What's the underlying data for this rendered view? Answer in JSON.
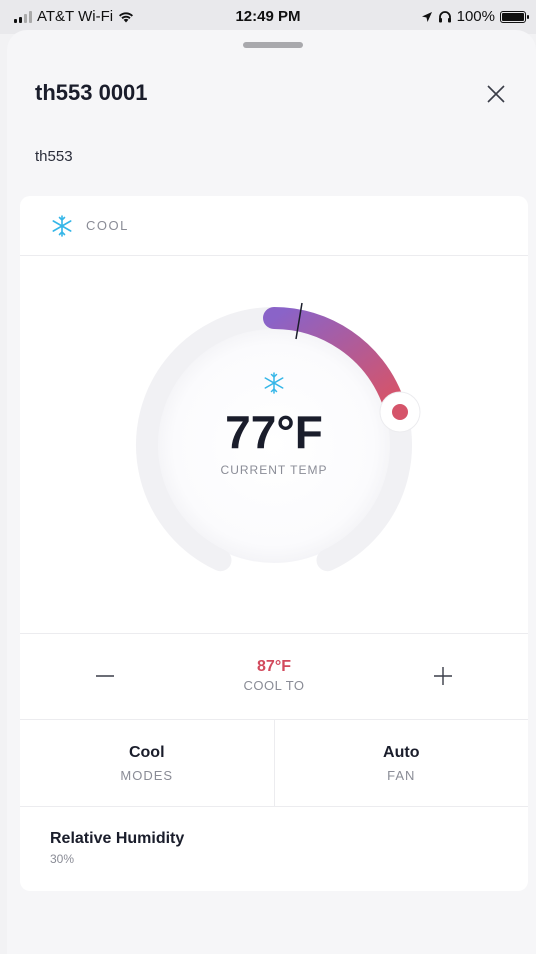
{
  "status_bar": {
    "carrier": "AT&T Wi-Fi",
    "time": "12:49 PM",
    "battery": "100%"
  },
  "device": {
    "name": "th553 0001",
    "model": "th553"
  },
  "mode": {
    "label": "COOL",
    "icon": "snowflake-icon"
  },
  "dial": {
    "current_temp": "77°F",
    "current_label": "CURRENT TEMP",
    "colors": {
      "start": "#8a63c8",
      "end": "#d5546a",
      "track": "#f1f1f4"
    }
  },
  "setpoint": {
    "value": "87°F",
    "label": "COOL TO",
    "color": "#d24a5d"
  },
  "modes": {
    "value": "Cool",
    "label": "MODES"
  },
  "fan": {
    "value": "Auto",
    "label": "FAN"
  },
  "humidity": {
    "label": "Relative Humidity",
    "value": "30%"
  },
  "accent": "#35b6e8"
}
